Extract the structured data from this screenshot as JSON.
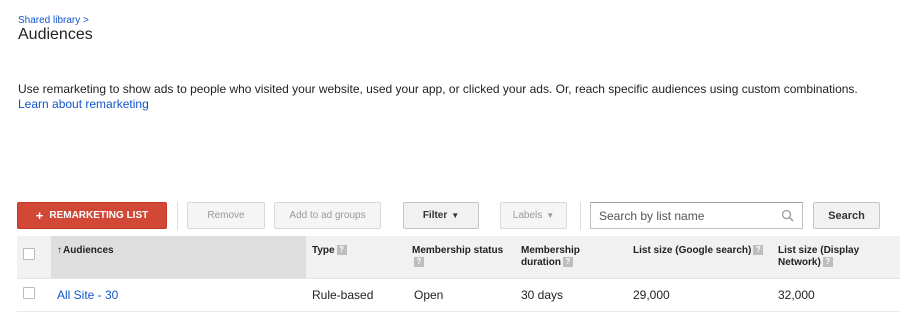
{
  "breadcrumb": "Shared library >",
  "title": "Audiences",
  "description": {
    "text": "Use remarketing to show ads to people who visited your website, used your app, or clicked your ads. Or, reach specific audiences using custom combinations.",
    "link": "Learn about remarketing"
  },
  "toolbar": {
    "remarketing_list": "REMARKETING LIST",
    "remove": "Remove",
    "add_to_ad_groups": "Add to ad groups",
    "filter": "Filter",
    "labels": "Labels",
    "search_placeholder": "Search by list name",
    "search": "Search"
  },
  "table": {
    "headers": {
      "audiences": "Audiences",
      "type": "Type",
      "membership_status": "Membership status",
      "membership_duration": "Membership duration",
      "list_size_search": "List size (Google search)",
      "list_size_display": "List size (Display Network)"
    },
    "rows": [
      {
        "audience": "All Site - 30",
        "type": "Rule-based",
        "status": "Open",
        "duration": "30 days",
        "size_search": "29,000",
        "size_display": "32,000"
      }
    ]
  },
  "icons": {
    "help": "help-icon",
    "search": "search-icon",
    "sort": "sort-up-icon",
    "caret": "caret-down-icon",
    "add": "plus-icon"
  },
  "colors": {
    "link": "#1155cc",
    "primary_button": "#d14836",
    "header_bg": "#f1f1f1",
    "sorted_header_bg": "#dedede"
  }
}
